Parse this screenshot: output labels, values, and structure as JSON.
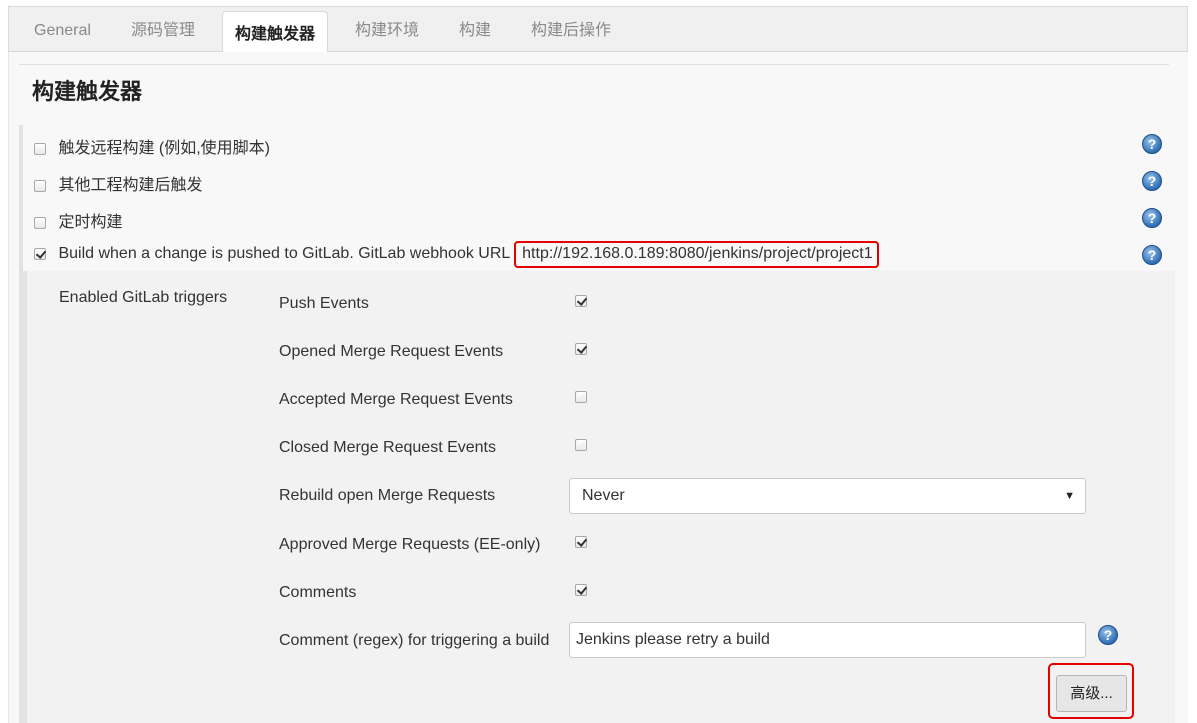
{
  "tabs": [
    {
      "label": "General"
    },
    {
      "label": "源码管理"
    },
    {
      "label": "构建触发器"
    },
    {
      "label": "构建环境"
    },
    {
      "label": "构建"
    },
    {
      "label": "构建后操作"
    }
  ],
  "section": {
    "title": "构建触发器"
  },
  "triggers": [
    {
      "label": "触发远程构建 (例如,使用脚本)",
      "checked": false
    },
    {
      "label": "其他工程构建后触发",
      "checked": false
    },
    {
      "label": "定时构建",
      "checked": false
    },
    {
      "label": "Build when a change is pushed to GitLab. GitLab webhook URL",
      "checked": true,
      "url": "http://192.168.0.189:8080/jenkins/project/project1"
    }
  ],
  "gitlab": {
    "group_label": "Enabled GitLab triggers",
    "options": [
      {
        "label": "Push Events",
        "checked": true
      },
      {
        "label": "Opened Merge Request Events",
        "checked": true
      },
      {
        "label": "Accepted Merge Request Events",
        "checked": false
      },
      {
        "label": "Closed Merge Request Events",
        "checked": false
      }
    ],
    "rebuild_label": "Rebuild open Merge Requests",
    "rebuild_value": "Never",
    "options2": [
      {
        "label": "Approved Merge Requests (EE-only)",
        "checked": true
      },
      {
        "label": "Comments",
        "checked": true
      }
    ],
    "comment_label": "Comment (regex) for triggering a build",
    "comment_value": "Jenkins please retry a build",
    "advanced_label": "高级..."
  },
  "icons": {
    "help": "question-mark-icon",
    "dropdown": "caret-down-icon",
    "check": "checkmark-icon"
  },
  "colors": {
    "highlight": "#e60000",
    "help": "#2f6eb5"
  }
}
